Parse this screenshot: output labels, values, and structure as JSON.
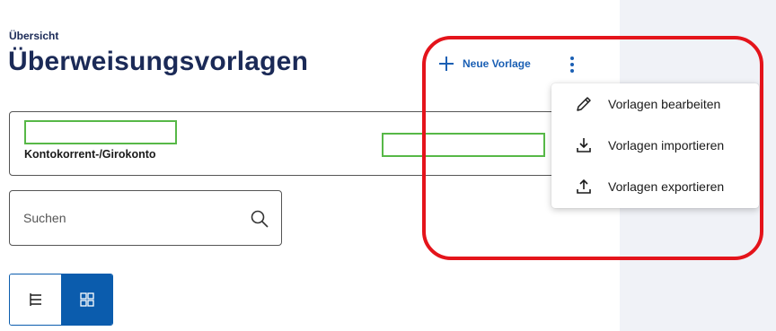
{
  "header": {
    "breadcrumb": "Übersicht",
    "title": "Überweisungsvorlagen",
    "new_template_label": "Neue Vorlage"
  },
  "account": {
    "name": "Kontokorrent-/Girokonto"
  },
  "search": {
    "placeholder": "Suchen"
  },
  "menu": {
    "items": [
      {
        "label": "Vorlagen bearbeiten",
        "icon": "pencil-icon"
      },
      {
        "label": "Vorlagen importieren",
        "icon": "download-icon"
      },
      {
        "label": "Vorlagen exportieren",
        "icon": "upload-icon"
      }
    ]
  },
  "view_toggle": {
    "selected": "grid",
    "options": [
      "list",
      "grid"
    ]
  },
  "colors": {
    "title": "#1b2a57",
    "accent": "#1a5fb4",
    "toggle_active": "#0b5cad",
    "annotation_red": "#e4141b",
    "annotation_green": "#57b847",
    "side_panel": "#f0f2f7"
  }
}
